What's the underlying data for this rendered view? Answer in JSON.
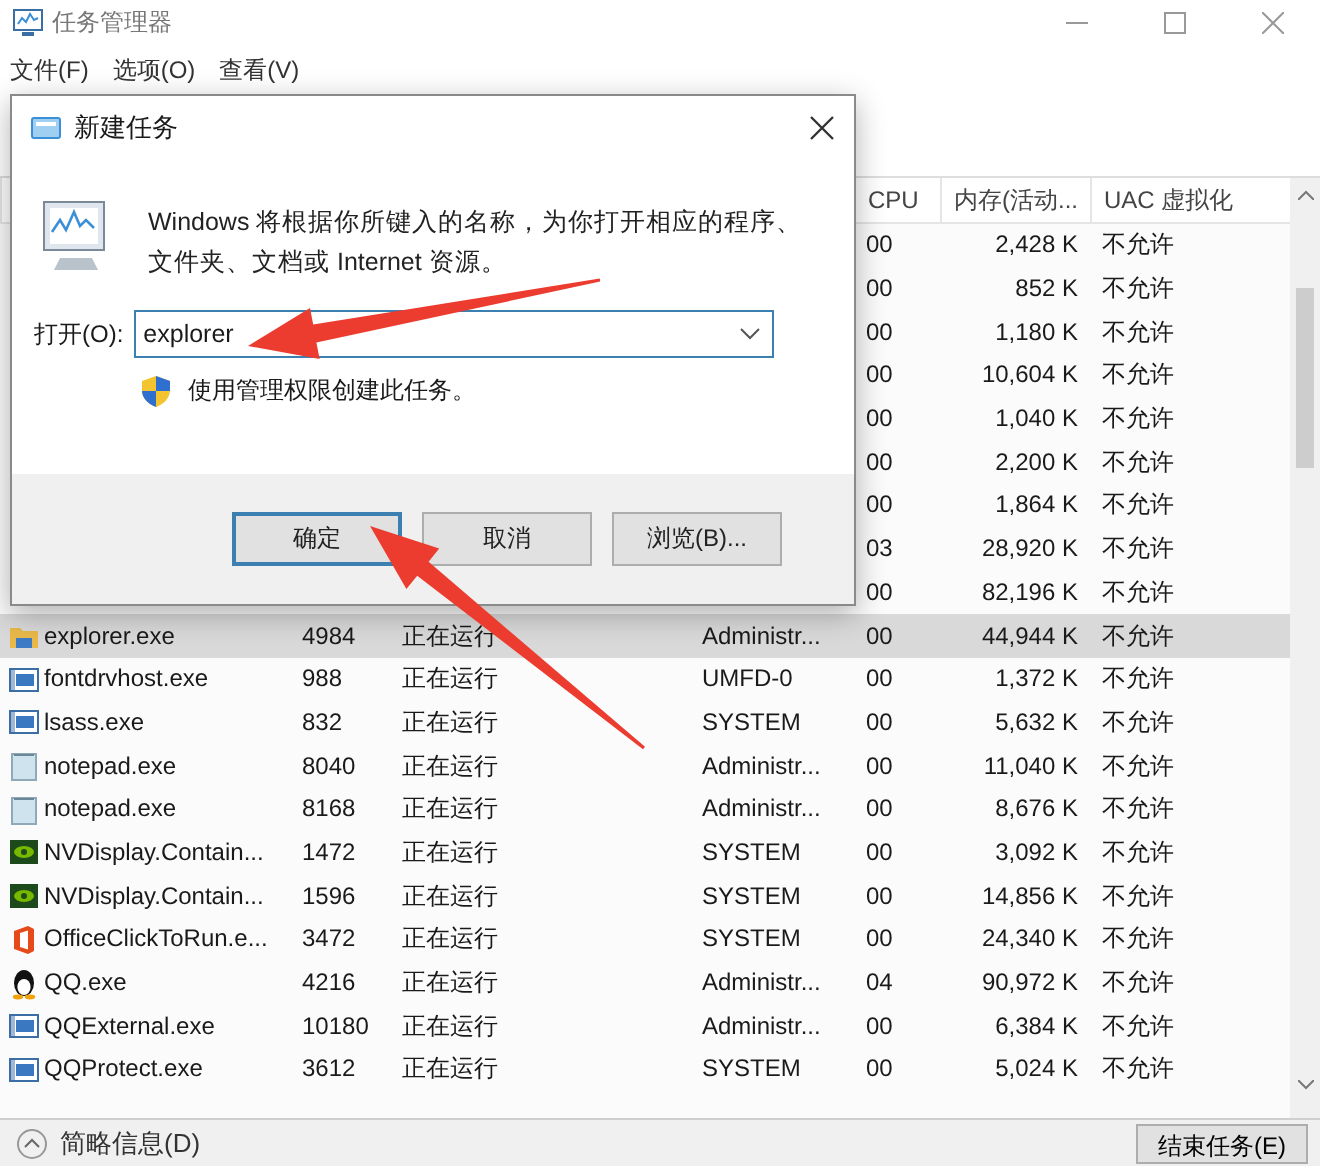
{
  "window": {
    "title": "任务管理器"
  },
  "menu": [
    {
      "label": "文件(F)"
    },
    {
      "label": "选项(O)"
    },
    {
      "label": "查看(V)"
    }
  ],
  "table": {
    "columns": [
      {
        "kind": "cpu",
        "label": "CPU"
      },
      {
        "kind": "memory",
        "label": "内存(活动..."
      },
      {
        "kind": "uac",
        "label": "UAC 虚拟化"
      }
    ],
    "rows": [
      {
        "cpu": "00",
        "memory": "2,428 K",
        "uac": "不允许",
        "selected": false
      },
      {
        "cpu": "00",
        "memory": "852 K",
        "uac": "不允许",
        "selected": false
      },
      {
        "cpu": "00",
        "memory": "1,180 K",
        "uac": "不允许",
        "selected": false
      },
      {
        "cpu": "00",
        "memory": "10,604 K",
        "uac": "不允许",
        "selected": false
      },
      {
        "cpu": "00",
        "memory": "1,040 K",
        "uac": "不允许",
        "selected": false
      },
      {
        "cpu": "00",
        "memory": "2,200 K",
        "uac": "不允许",
        "selected": false
      },
      {
        "cpu": "00",
        "memory": "1,864 K",
        "uac": "不允许",
        "selected": false
      },
      {
        "cpu": "03",
        "memory": "28,920 K",
        "uac": "不允许",
        "selected": false
      },
      {
        "cpu": "00",
        "memory": "82,196 K",
        "uac": "不允许",
        "selected": false
      },
      {
        "kind": "folder",
        "name": "explorer.exe",
        "pid": "4984",
        "status": "正在运行",
        "user": "Administr...",
        "cpu": "00",
        "memory": "44,944 K",
        "uac": "不允许",
        "selected": true
      },
      {
        "kind": "app",
        "name": "fontdrvhost.exe",
        "pid": "988",
        "status": "正在运行",
        "user": "UMFD-0",
        "cpu": "00",
        "memory": "1,372 K",
        "uac": "不允许",
        "selected": false
      },
      {
        "kind": "app",
        "name": "lsass.exe",
        "pid": "832",
        "status": "正在运行",
        "user": "SYSTEM",
        "cpu": "00",
        "memory": "5,632 K",
        "uac": "不允许",
        "selected": false
      },
      {
        "kind": "notepad",
        "name": "notepad.exe",
        "pid": "8040",
        "status": "正在运行",
        "user": "Administr...",
        "cpu": "00",
        "memory": "11,040 K",
        "uac": "不允许",
        "selected": false
      },
      {
        "kind": "notepad",
        "name": "notepad.exe",
        "pid": "8168",
        "status": "正在运行",
        "user": "Administr...",
        "cpu": "00",
        "memory": "8,676 K",
        "uac": "不允许",
        "selected": false
      },
      {
        "kind": "nvidia",
        "name": "NVDisplay.Contain...",
        "pid": "1472",
        "status": "正在运行",
        "user": "SYSTEM",
        "cpu": "00",
        "memory": "3,092 K",
        "uac": "不允许",
        "selected": false
      },
      {
        "kind": "nvidia",
        "name": "NVDisplay.Contain...",
        "pid": "1596",
        "status": "正在运行",
        "user": "SYSTEM",
        "cpu": "00",
        "memory": "14,856 K",
        "uac": "不允许",
        "selected": false
      },
      {
        "kind": "office",
        "name": "OfficeClickToRun.e...",
        "pid": "3472",
        "status": "正在运行",
        "user": "SYSTEM",
        "cpu": "00",
        "memory": "24,340 K",
        "uac": "不允许",
        "selected": false
      },
      {
        "kind": "penguin",
        "name": "QQ.exe",
        "pid": "4216",
        "status": "正在运行",
        "user": "Administr...",
        "cpu": "04",
        "memory": "90,972 K",
        "uac": "不允许",
        "selected": false
      },
      {
        "kind": "app",
        "name": "QQExternal.exe",
        "pid": "10180",
        "status": "正在运行",
        "user": "Administr...",
        "cpu": "00",
        "memory": "6,384 K",
        "uac": "不允许",
        "selected": false
      },
      {
        "kind": "app",
        "name": "QQProtect.exe",
        "pid": "3612",
        "status": "正在运行",
        "user": "SYSTEM",
        "cpu": "00",
        "memory": "5,024 K",
        "uac": "不允许",
        "selected": false
      }
    ]
  },
  "footer": {
    "details": "简略信息(D)",
    "end_task": "结束任务(E)"
  },
  "dialog": {
    "title": "新建任务",
    "message": [
      "Windows 将根据你所键入的名称，为你打开相应的程序、",
      "文件夹、文档或 Internet 资源。"
    ],
    "open_label": "打开(O):",
    "open_value": "explorer",
    "admin_label": "使用管理权限创建此任务。",
    "buttons": [
      {
        "label": "确定",
        "default": true
      },
      {
        "label": "取消",
        "default": false
      },
      {
        "label": "浏览(B)...",
        "default": false
      }
    ]
  }
}
